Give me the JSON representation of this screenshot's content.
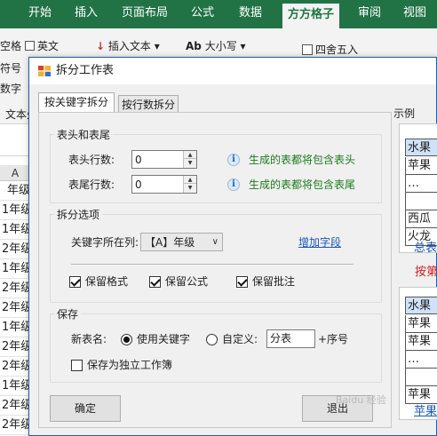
{
  "ribbon": {
    "tabs": [
      "开始",
      "插入",
      "页面布局",
      "公式",
      "数据",
      "方方格子",
      "审阅",
      "视图"
    ],
    "active_tab": "方方格子",
    "items": {
      "cut_label_1": "空格",
      "english_label": "英文",
      "insert_text_label": "插入文本",
      "case_label": "大小写",
      "round_label": "四舍五入",
      "cut_label_2": "符号",
      "cut_label_3": "数字",
      "text_label": "文本处"
    }
  },
  "sheet": {
    "column_header": "A",
    "cells": [
      "年级",
      "1年级",
      "1年级",
      "2年级",
      "1年级",
      "2年级",
      "2年级",
      "1年级",
      "2年级",
      "2年级",
      "1年级",
      "2年级",
      "2年级",
      "2年级"
    ]
  },
  "dialog": {
    "title": "拆分工作表",
    "tabs": [
      "按关键字拆分",
      "按行数拆分"
    ],
    "header_footer": {
      "title": "表头和表尾",
      "header_rows_label": "表头行数:",
      "header_rows_value": "0",
      "header_hint": "生成的表都将包含表头",
      "footer_rows_label": "表尾行数:",
      "footer_rows_value": "0",
      "footer_hint": "生成的表都将包含表尾"
    },
    "split_options": {
      "title": "拆分选项",
      "key_column_label": "关键字所在列:",
      "key_column_value": "【A】年级",
      "add_field_link": "增加字段",
      "keep_format": "保留格式",
      "keep_formula": "保留公式",
      "keep_comment": "保留批注"
    },
    "save": {
      "title": "保存",
      "new_name_label": "新表名:",
      "use_keyword": "使用关键字",
      "custom": "自定义:",
      "custom_value": "分表",
      "suffix": "+序号",
      "save_as_workbook": "保存为独立工作簿"
    },
    "ok_label": "确定",
    "exit_label": "退出"
  },
  "preview": {
    "label": "示例",
    "box1_cells": [
      "水果",
      "苹果",
      "…",
      "西瓜",
      "火龙"
    ],
    "box1_link": "总表",
    "red_caption": "按第",
    "box2_cells": [
      "水果",
      "苹果",
      "苹果",
      "…",
      "苹果"
    ],
    "box2_link": "苹果"
  },
  "watermark": "Baidu 经验"
}
